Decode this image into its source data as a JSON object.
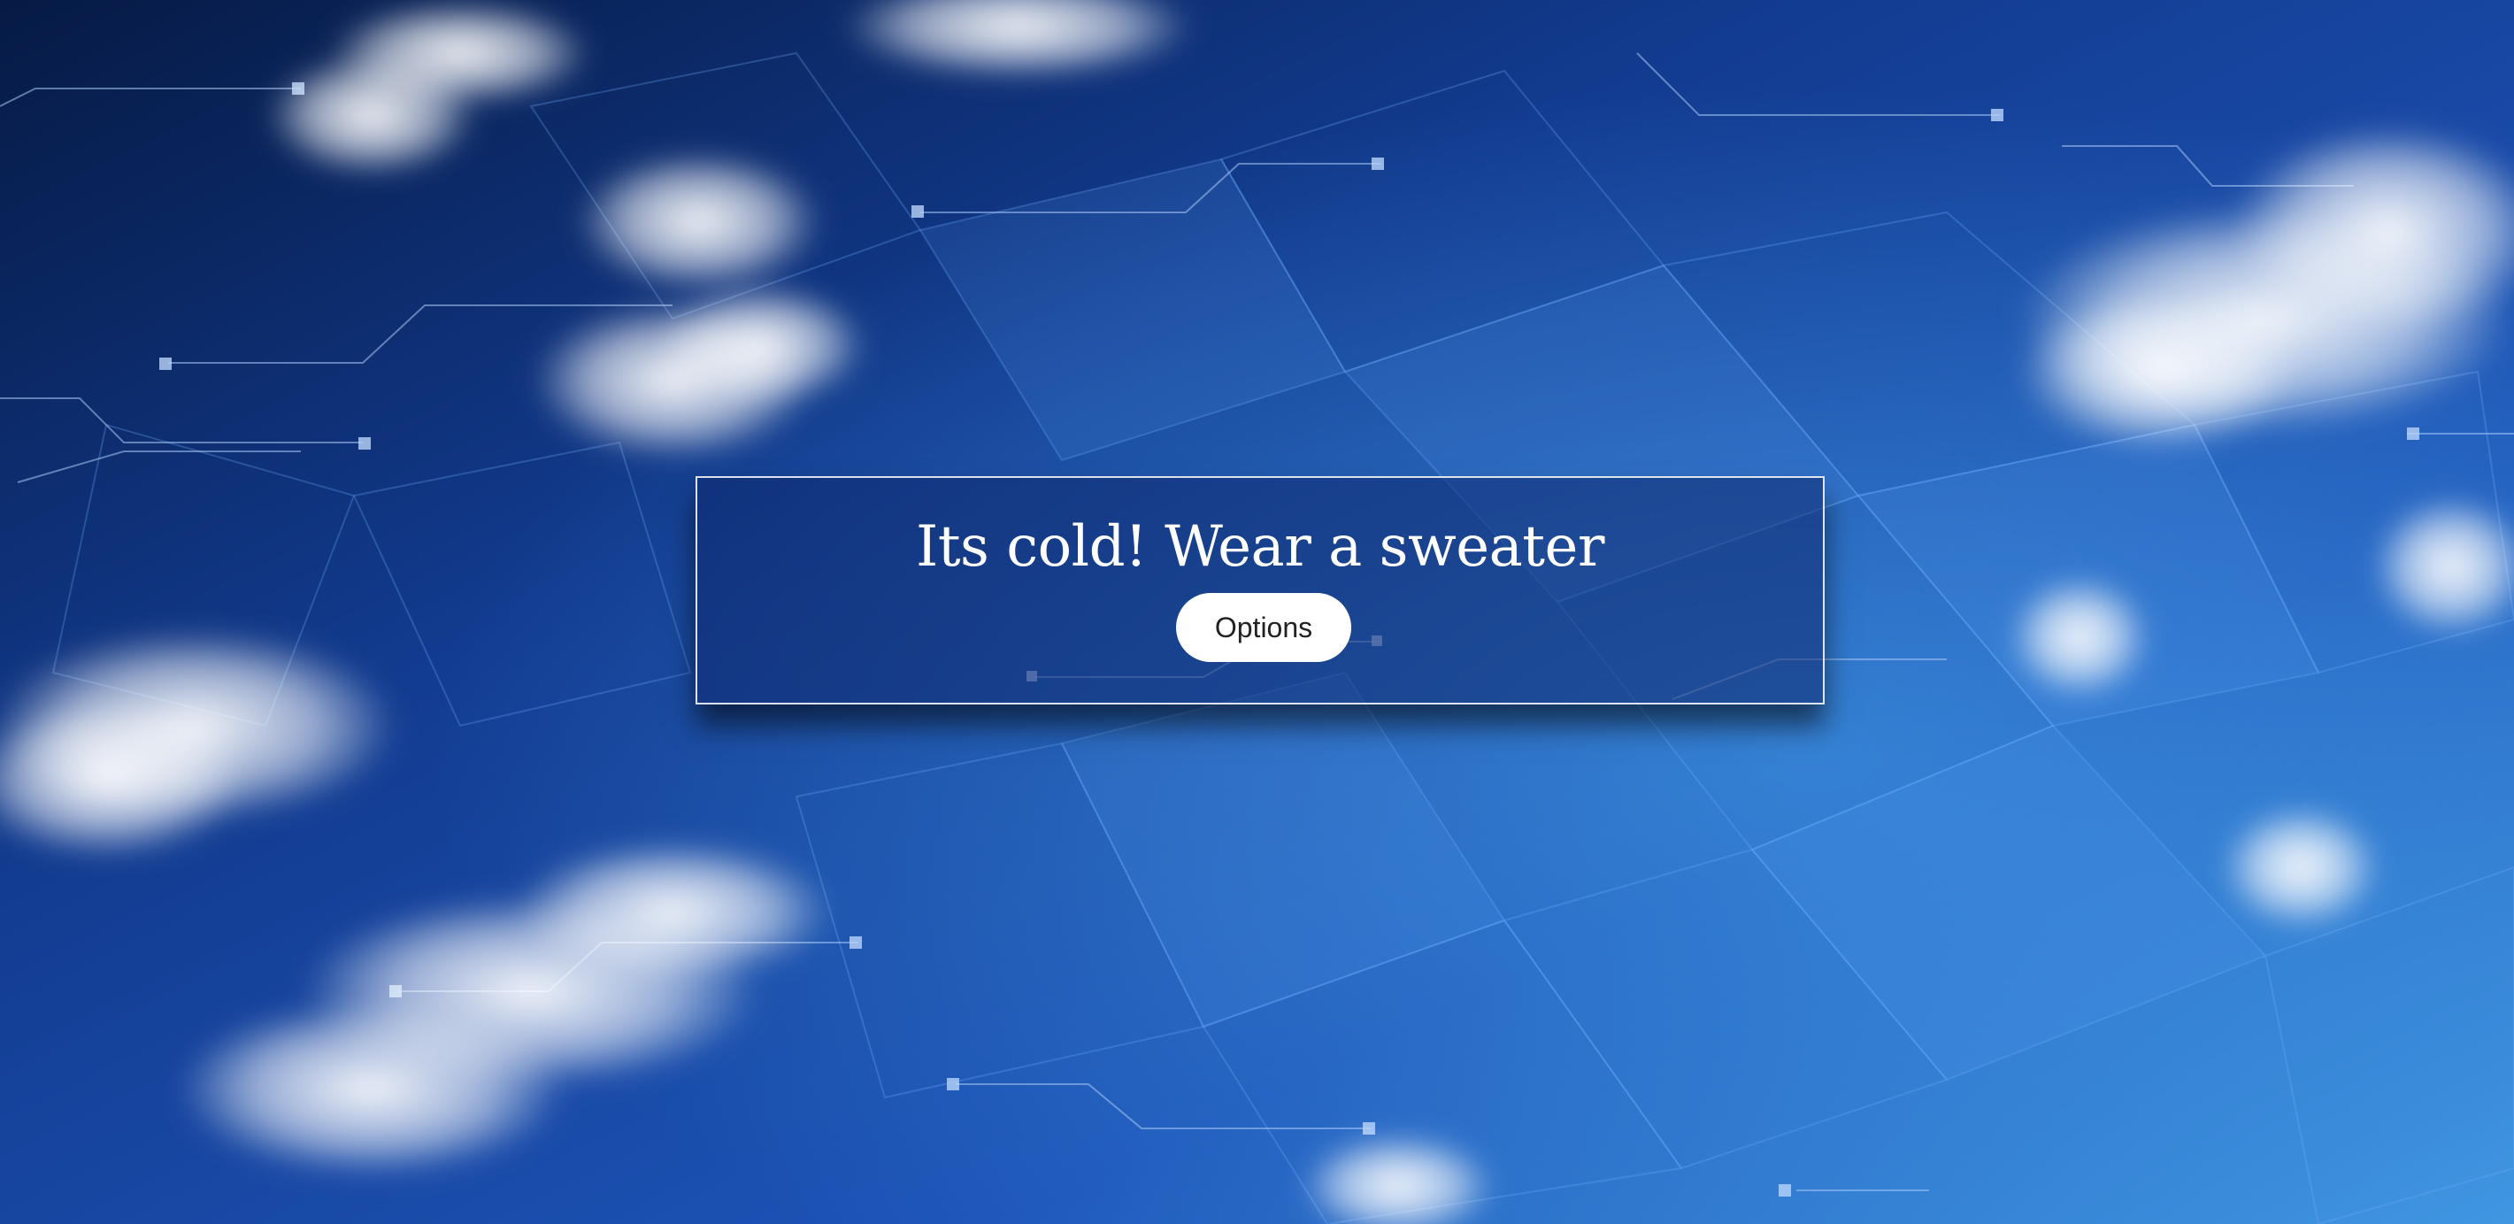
{
  "banner": {
    "headline": "Its cold! Wear a sweater",
    "options_label": "Options"
  },
  "colors": {
    "sky_dark": "#061a44",
    "sky_mid": "#1d54b8",
    "sky_light": "#3f95e0",
    "banner_fill": "#0f286e",
    "button_bg": "#ffffff"
  }
}
